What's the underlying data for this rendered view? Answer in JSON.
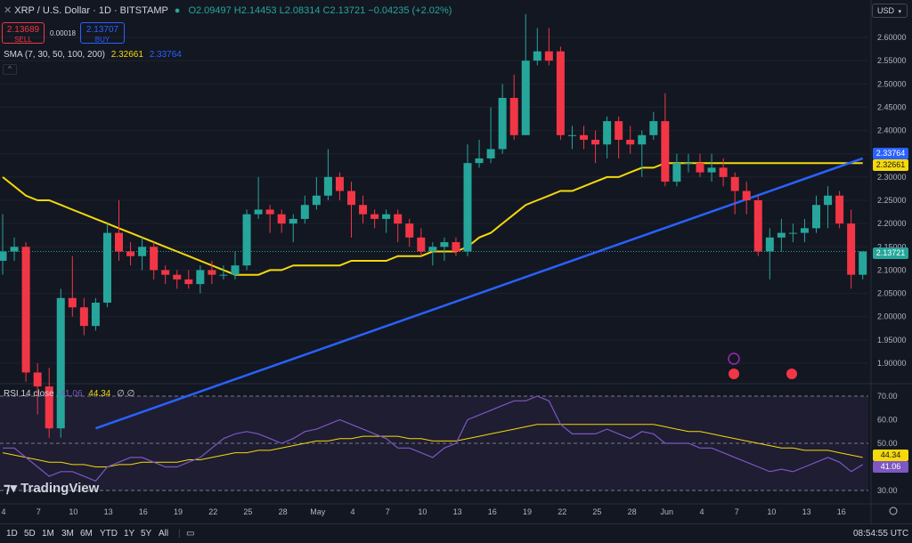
{
  "header": {
    "symbol": "XRP / U.S. Dollar · 1D · BITSTAMP",
    "ohlc": "O2.09497 H2.14453 L2.08314 C2.13721 −0.04235 (+2.02%)",
    "sell_price": "2.13689",
    "sell_label": "SELL",
    "spread": "0.00018",
    "buy_price": "2.13707",
    "buy_label": "BUY",
    "sma_label": "SMA (7, 30, 50, 100, 200)",
    "sma_value_1": "2.32661",
    "sma_value_2": "2.33764",
    "currency": "USD",
    "collapse": "^"
  },
  "rsi_header": {
    "label": "RSI 14 close",
    "value": "41.06",
    "ma_value": "44.34",
    "extra": "∅ ∅"
  },
  "price_tags": {
    "sma_blue": "2.33764",
    "sma_yellow": "2.32661",
    "last": "2.13721"
  },
  "rsi_tags": {
    "ma": "44.34",
    "rsi": "41.06"
  },
  "logo_text": "TradingView",
  "bottom": {
    "timeframes": [
      "1D",
      "5D",
      "1M",
      "3M",
      "6M",
      "YTD",
      "1Y",
      "5Y",
      "All"
    ],
    "time": "08:54:55 UTC"
  },
  "colors": {
    "up": "#26a69a",
    "down": "#f23645",
    "sma_yellow": "#f5d90a",
    "sma_blue": "#2962ff",
    "rsi": "#7e57c2"
  },
  "chart_data": {
    "type": "candlestick",
    "price_axis": {
      "ticks": [
        "2.60000",
        "2.55000",
        "2.50000",
        "2.45000",
        "2.40000",
        "2.35000",
        "2.30000",
        "2.25000",
        "2.20000",
        "2.15000",
        "2.10000",
        "2.05000",
        "2.00000",
        "1.95000",
        "1.90000"
      ]
    },
    "rsi_axis": {
      "ticks": [
        "70.00",
        "60.00",
        "50.00",
        "40.00",
        "30.00"
      ]
    },
    "x_ticks": [
      "4",
      "7",
      "10",
      "13",
      "16",
      "19",
      "22",
      "25",
      "28",
      "May",
      "4",
      "7",
      "10",
      "13",
      "16",
      "19",
      "22",
      "25",
      "28",
      "Jun",
      "4",
      "7",
      "10",
      "13",
      "16"
    ],
    "candles": [
      [
        2.12,
        2.14,
        2.22,
        2.09
      ],
      [
        2.14,
        2.15,
        2.17,
        2.12
      ],
      [
        2.15,
        1.88,
        2.16,
        1.86
      ],
      [
        1.88,
        1.85,
        1.9,
        1.79
      ],
      [
        1.85,
        1.76,
        1.89,
        1.74
      ],
      [
        1.76,
        2.04,
        2.06,
        1.74
      ],
      [
        2.04,
        2.02,
        2.13,
        2.0
      ],
      [
        2.02,
        1.98,
        2.04,
        1.96
      ],
      [
        1.98,
        2.03,
        2.04,
        1.97
      ],
      [
        2.03,
        2.18,
        2.2,
        2.02
      ],
      [
        2.18,
        2.14,
        2.25,
        2.12
      ],
      [
        2.14,
        2.13,
        2.16,
        2.11
      ],
      [
        2.13,
        2.15,
        2.17,
        2.1
      ],
      [
        2.15,
        2.1,
        2.16,
        2.08
      ],
      [
        2.1,
        2.09,
        2.11,
        2.07
      ],
      [
        2.09,
        2.08,
        2.1,
        2.06
      ],
      [
        2.08,
        2.07,
        2.1,
        2.06
      ],
      [
        2.07,
        2.1,
        2.11,
        2.05
      ],
      [
        2.1,
        2.09,
        2.12,
        2.07
      ],
      [
        2.09,
        2.09,
        2.11,
        2.08
      ],
      [
        2.09,
        2.11,
        2.14,
        2.08
      ],
      [
        2.11,
        2.22,
        2.23,
        2.1
      ],
      [
        2.22,
        2.23,
        2.3,
        2.21
      ],
      [
        2.23,
        2.22,
        2.24,
        2.18
      ],
      [
        2.22,
        2.2,
        2.23,
        2.18
      ],
      [
        2.2,
        2.21,
        2.22,
        2.16
      ],
      [
        2.21,
        2.24,
        2.26,
        2.2
      ],
      [
        2.24,
        2.26,
        2.3,
        2.23
      ],
      [
        2.26,
        2.3,
        2.36,
        2.25
      ],
      [
        2.3,
        2.27,
        2.31,
        2.25
      ],
      [
        2.27,
        2.24,
        2.29,
        2.17
      ],
      [
        2.24,
        2.22,
        2.26,
        2.2
      ],
      [
        2.22,
        2.21,
        2.23,
        2.19
      ],
      [
        2.21,
        2.22,
        2.23,
        2.18
      ],
      [
        2.22,
        2.2,
        2.23,
        2.16
      ],
      [
        2.2,
        2.17,
        2.21,
        2.15
      ],
      [
        2.17,
        2.14,
        2.19,
        2.13
      ],
      [
        2.14,
        2.15,
        2.16,
        2.11
      ],
      [
        2.15,
        2.16,
        2.17,
        2.12
      ],
      [
        2.16,
        2.14,
        2.17,
        2.13
      ],
      [
        2.14,
        2.33,
        2.37,
        2.13
      ],
      [
        2.33,
        2.34,
        2.38,
        2.32
      ],
      [
        2.34,
        2.36,
        2.45,
        2.33
      ],
      [
        2.36,
        2.47,
        2.5,
        2.35
      ],
      [
        2.47,
        2.39,
        2.52,
        2.38
      ],
      [
        2.39,
        2.55,
        2.65,
        2.4
      ],
      [
        2.55,
        2.57,
        2.62,
        2.54
      ],
      [
        2.57,
        2.55,
        2.62,
        2.54
      ],
      [
        2.57,
        2.39,
        2.58,
        2.38
      ],
      [
        2.39,
        2.39,
        2.41,
        2.36
      ],
      [
        2.39,
        2.38,
        2.41,
        2.36
      ],
      [
        2.38,
        2.37,
        2.4,
        2.33
      ],
      [
        2.37,
        2.42,
        2.43,
        2.34
      ],
      [
        2.42,
        2.38,
        2.43,
        2.34
      ],
      [
        2.38,
        2.37,
        2.41,
        2.35
      ],
      [
        2.37,
        2.39,
        2.4,
        2.3
      ],
      [
        2.39,
        2.42,
        2.44,
        2.38
      ],
      [
        2.42,
        2.29,
        2.48,
        2.28
      ],
      [
        2.29,
        2.33,
        2.35,
        2.28
      ],
      [
        2.33,
        2.33,
        2.35,
        2.31
      ],
      [
        2.33,
        2.31,
        2.35,
        2.3
      ],
      [
        2.31,
        2.32,
        2.35,
        2.29
      ],
      [
        2.32,
        2.3,
        2.34,
        2.28
      ],
      [
        2.3,
        2.27,
        2.31,
        2.22
      ],
      [
        2.27,
        2.25,
        2.29,
        2.22
      ],
      [
        2.25,
        2.14,
        2.26,
        2.13
      ],
      [
        2.14,
        2.17,
        2.19,
        2.08
      ],
      [
        2.17,
        2.18,
        2.21,
        2.14
      ],
      [
        2.18,
        2.18,
        2.2,
        2.16
      ],
      [
        2.18,
        2.19,
        2.21,
        2.16
      ],
      [
        2.19,
        2.24,
        2.26,
        2.18
      ],
      [
        2.24,
        2.26,
        2.28,
        2.19
      ],
      [
        2.26,
        2.2,
        2.27,
        2.19
      ],
      [
        2.2,
        2.09,
        2.23,
        2.06
      ],
      [
        2.09,
        2.14,
        2.14,
        2.08
      ]
    ],
    "sma_yellow": [
      2.3,
      2.28,
      2.26,
      2.25,
      2.25,
      2.24,
      2.23,
      2.22,
      2.21,
      2.2,
      2.19,
      2.18,
      2.17,
      2.16,
      2.15,
      2.14,
      2.13,
      2.12,
      2.11,
      2.1,
      2.09,
      2.09,
      2.09,
      2.1,
      2.1,
      2.11,
      2.11,
      2.11,
      2.11,
      2.11,
      2.12,
      2.12,
      2.12,
      2.12,
      2.13,
      2.13,
      2.13,
      2.14,
      2.14,
      2.14,
      2.15,
      2.17,
      2.18,
      2.2,
      2.22,
      2.24,
      2.25,
      2.26,
      2.27,
      2.27,
      2.28,
      2.29,
      2.3,
      2.3,
      2.31,
      2.32,
      2.32,
      2.33,
      2.33,
      2.33,
      2.33,
      2.33,
      2.33,
      2.33,
      2.33,
      2.33,
      2.33,
      2.33,
      2.33,
      2.33,
      2.33,
      2.33,
      2.33,
      2.33,
      2.33
    ],
    "sma_blue_start": {
      "candle": 8,
      "value": 1.76
    },
    "sma_blue_end": {
      "candle": 74,
      "value": 2.34
    },
    "rsi": [
      48,
      48,
      44,
      40,
      36,
      38,
      38,
      36,
      34,
      40,
      42,
      44,
      44,
      42,
      40,
      40,
      42,
      44,
      48,
      52,
      54,
      55,
      54,
      52,
      50,
      52,
      55,
      56,
      58,
      60,
      58,
      56,
      54,
      52,
      48,
      48,
      46,
      44,
      48,
      50,
      60,
      62,
      64,
      66,
      68,
      68,
      70,
      68,
      58,
      54,
      54,
      54,
      56,
      54,
      52,
      55,
      54,
      50,
      50,
      50,
      48,
      48,
      46,
      44,
      42,
      40,
      38,
      39,
      38,
      40,
      42,
      44,
      42,
      38,
      41
    ],
    "rsi_ma": [
      46,
      45,
      44,
      43,
      42,
      42,
      41,
      41,
      40,
      40,
      41,
      41,
      42,
      42,
      42,
      42,
      43,
      43,
      44,
      45,
      46,
      46,
      47,
      47,
      48,
      49,
      50,
      51,
      51,
      52,
      52,
      53,
      53,
      53,
      53,
      52,
      52,
      51,
      51,
      51,
      52,
      53,
      54,
      55,
      56,
      57,
      58,
      58,
      58,
      58,
      58,
      58,
      58,
      58,
      58,
      58,
      58,
      57,
      56,
      55,
      55,
      54,
      53,
      52,
      51,
      50,
      49,
      48,
      48,
      47,
      47,
      47,
      46,
      45,
      44
    ]
  }
}
